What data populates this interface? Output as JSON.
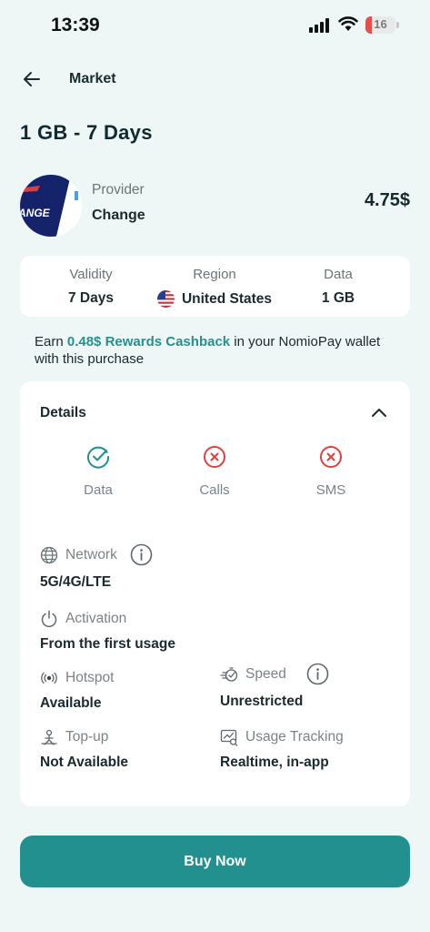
{
  "status_bar": {
    "time": "13:39",
    "battery": "16"
  },
  "header": {
    "back_icon": "arrow-left-icon",
    "title": "Market"
  },
  "plan": {
    "title": "1 GB - 7 Days"
  },
  "provider": {
    "label": "Provider",
    "name": "Change",
    "logo_text": "ANGE",
    "price": "4.75$"
  },
  "summary": {
    "validity_label": "Validity",
    "validity_value": "7 Days",
    "region_label": "Region",
    "region_value": "United States",
    "region_flag": "us-flag-icon",
    "data_label": "Data",
    "data_value": "1 GB"
  },
  "cashback": {
    "prefix": "Earn ",
    "highlight": "0.48$ Rewards Cashback",
    "suffix": " in your NomioPay wallet with this purchase"
  },
  "details": {
    "title": "Details",
    "features": [
      {
        "label": "Data",
        "status": "included",
        "icon": "check-circle-icon"
      },
      {
        "label": "Calls",
        "status": "excluded",
        "icon": "x-circle-icon"
      },
      {
        "label": "SMS",
        "status": "excluded",
        "icon": "x-circle-icon"
      }
    ],
    "network": {
      "label": "Network",
      "value": "5G/4G/LTE"
    },
    "activation": {
      "label": "Activation",
      "value": "From the first usage"
    },
    "hotspot": {
      "label": "Hotspot",
      "value": "Available"
    },
    "speed": {
      "label": "Speed",
      "value": "Unrestricted"
    },
    "topup": {
      "label": "Top-up",
      "value": "Not Available"
    },
    "usage_tracking": {
      "label": "Usage Tracking",
      "value": "Realtime, in-app"
    }
  },
  "buy_button": {
    "label": "Buy Now"
  },
  "colors": {
    "accent": "#22908f",
    "error": "#e2403f",
    "background": "#eef6f6"
  }
}
